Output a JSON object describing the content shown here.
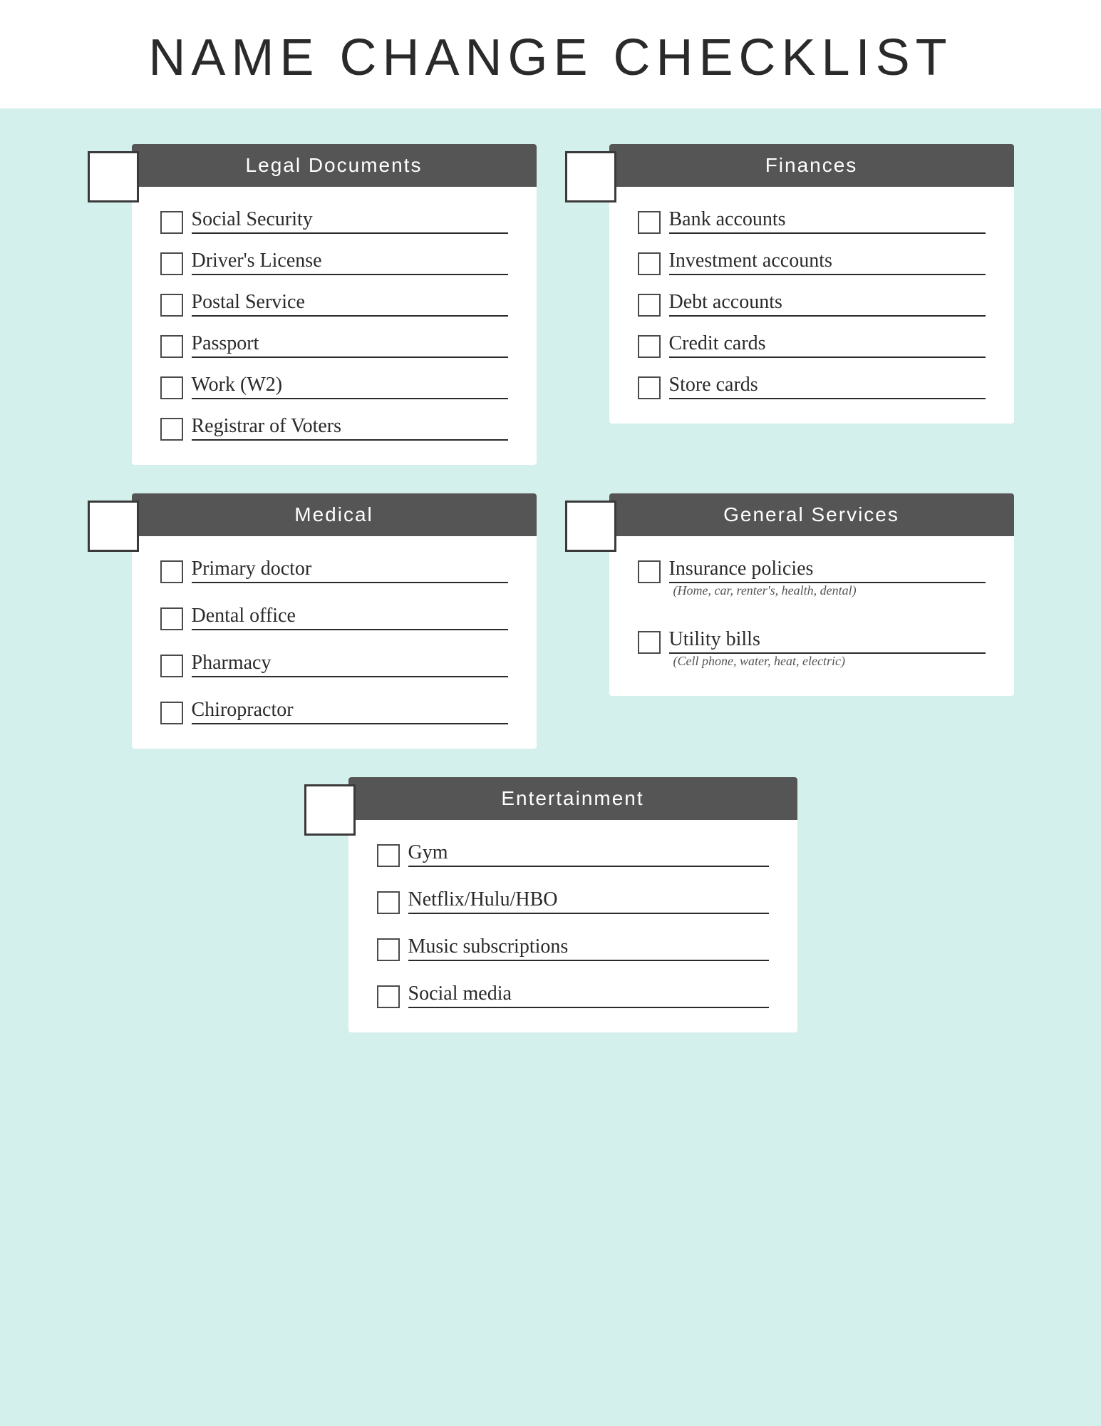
{
  "page": {
    "title": "NAME CHANGE CHECKLIST",
    "background_color": "#d4f0ec"
  },
  "sections": {
    "legal": {
      "label": "Legal Documents",
      "items": [
        {
          "label": "Social Security"
        },
        {
          "label": "Driver's License"
        },
        {
          "label": "Postal Service"
        },
        {
          "label": "Passport"
        },
        {
          "label": "Work (W2)"
        },
        {
          "label": "Registrar of Voters"
        }
      ]
    },
    "finances": {
      "label": "Finances",
      "items": [
        {
          "label": "Bank accounts"
        },
        {
          "label": "Investment accounts"
        },
        {
          "label": "Debt accounts"
        },
        {
          "label": "Credit cards"
        },
        {
          "label": "Store cards"
        }
      ]
    },
    "medical": {
      "label": "Medical",
      "items": [
        {
          "label": "Primary doctor"
        },
        {
          "label": "Dental office"
        },
        {
          "label": "Pharmacy"
        },
        {
          "label": "Chiropractor"
        }
      ]
    },
    "general": {
      "label": "General Services",
      "items": [
        {
          "label": "Insurance policies",
          "sublabel": "(Home, car, renter's, health, dental)"
        },
        {
          "label": "Utility bills",
          "sublabel": "(Cell phone, water, heat, electric)"
        }
      ]
    },
    "entertainment": {
      "label": "Entertainment",
      "items": [
        {
          "label": "Gym"
        },
        {
          "label": "Netflix/Hulu/HBO"
        },
        {
          "label": "Music subscriptions"
        },
        {
          "label": "Social media"
        }
      ]
    }
  }
}
